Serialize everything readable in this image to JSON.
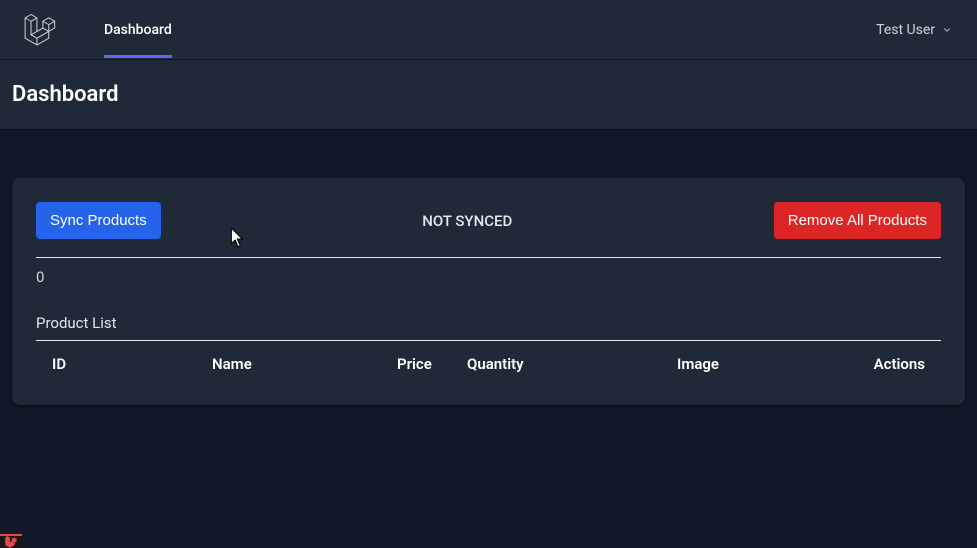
{
  "nav": {
    "dashboard_label": "Dashboard",
    "user_name": "Test User"
  },
  "header": {
    "title": "Dashboard"
  },
  "toolbar": {
    "sync_label": "Sync Products",
    "sync_status": "NOT SYNCED",
    "remove_label": "Remove All Products"
  },
  "products": {
    "count": "0",
    "list_title": "Product List",
    "columns": {
      "id": "ID",
      "name": "Name",
      "price": "Price",
      "quantity": "Quantity",
      "image": "Image",
      "actions": "Actions"
    },
    "rows": []
  },
  "colors": {
    "primary": "#2563eb",
    "danger": "#dc2626",
    "accent": "#6366f1",
    "bg": "#111827",
    "card": "#1f2937"
  }
}
